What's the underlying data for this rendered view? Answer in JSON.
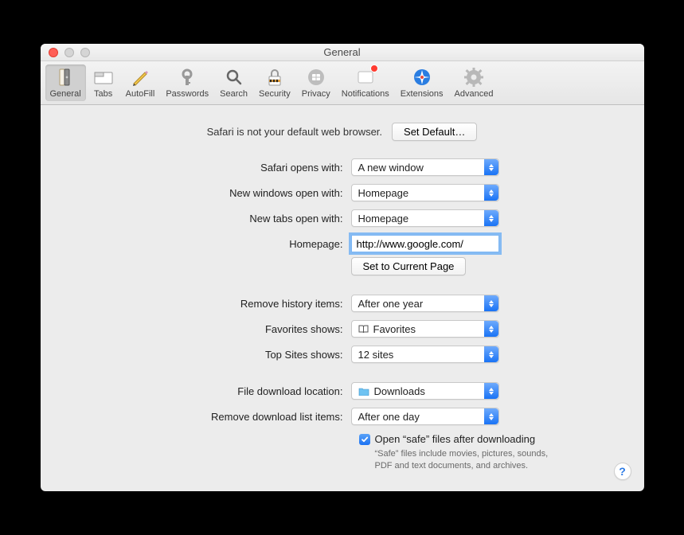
{
  "window": {
    "title": "General"
  },
  "toolbar": {
    "items": [
      {
        "label": "General"
      },
      {
        "label": "Tabs"
      },
      {
        "label": "AutoFill"
      },
      {
        "label": "Passwords"
      },
      {
        "label": "Search"
      },
      {
        "label": "Security"
      },
      {
        "label": "Privacy"
      },
      {
        "label": "Notifications"
      },
      {
        "label": "Extensions"
      },
      {
        "label": "Advanced"
      }
    ]
  },
  "banner": {
    "message": "Safari is not your default web browser.",
    "button": "Set Default…"
  },
  "labels": {
    "opens_with": "Safari opens with:",
    "new_windows": "New windows open with:",
    "new_tabs": "New tabs open with:",
    "homepage": "Homepage:",
    "set_current": "Set to Current Page",
    "remove_history": "Remove history items:",
    "favorites_shows": "Favorites shows:",
    "top_sites_shows": "Top Sites shows:",
    "download_location": "File download location:",
    "remove_downloads": "Remove download list items:",
    "open_safe": "Open “safe” files after downloading",
    "safe_help": "“Safe” files include movies, pictures, sounds, PDF and text documents, and archives."
  },
  "values": {
    "opens_with": "A new window",
    "new_windows": "Homepage",
    "new_tabs": "Homepage",
    "homepage": "http://www.google.com/",
    "remove_history": "After one year",
    "favorites_shows": "Favorites",
    "top_sites_shows": "12 sites",
    "download_location": "Downloads",
    "remove_downloads": "After one day",
    "open_safe_checked": true
  },
  "help": "?"
}
